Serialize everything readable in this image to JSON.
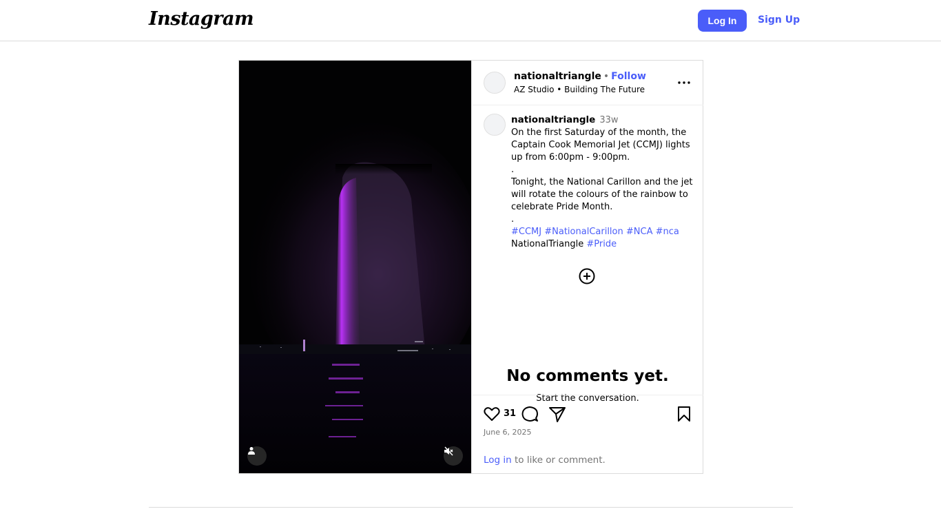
{
  "nav": {
    "logo_text": "Instagram",
    "login_label": "Log In",
    "signup_label": "Sign Up",
    "accent_color": "#4a5df9"
  },
  "post": {
    "header": {
      "username": "nationaltriangle",
      "separator": "•",
      "follow_label": "Follow",
      "subtitle": "AZ Studio • Building The Future",
      "more_label": "•••"
    },
    "caption": {
      "username": "nationaltriangle",
      "time_ago": "33w",
      "line1": "On the first Saturday of the month, the Captain Cook Memorial Jet (CCMJ) lights up from 6:00pm - 9:00pm.",
      "dot1": ".",
      "line2": "Tonight, the National Carillon and the jet will rotate the colours of the rainbow to celebrate Pride Month.",
      "dot2": ".",
      "tags": {
        "t1": "#CCMJ",
        "t2": "#NationalCarillon",
        "t3": "#NCA",
        "t4": "#nca",
        "plain": "NationalTriangle",
        "t5": "#Pride"
      }
    },
    "comments": {
      "empty_title": "No comments yet.",
      "empty_subtitle": "Start the conversation."
    },
    "actions": {
      "like_count": "31",
      "date": "June 6, 2025",
      "login_link": "Log in",
      "login_rest": " to like or comment."
    },
    "media": {
      "icons": [
        "user-tag-icon",
        "muted-speaker-icon"
      ],
      "glow_color": "#b514e8"
    }
  }
}
